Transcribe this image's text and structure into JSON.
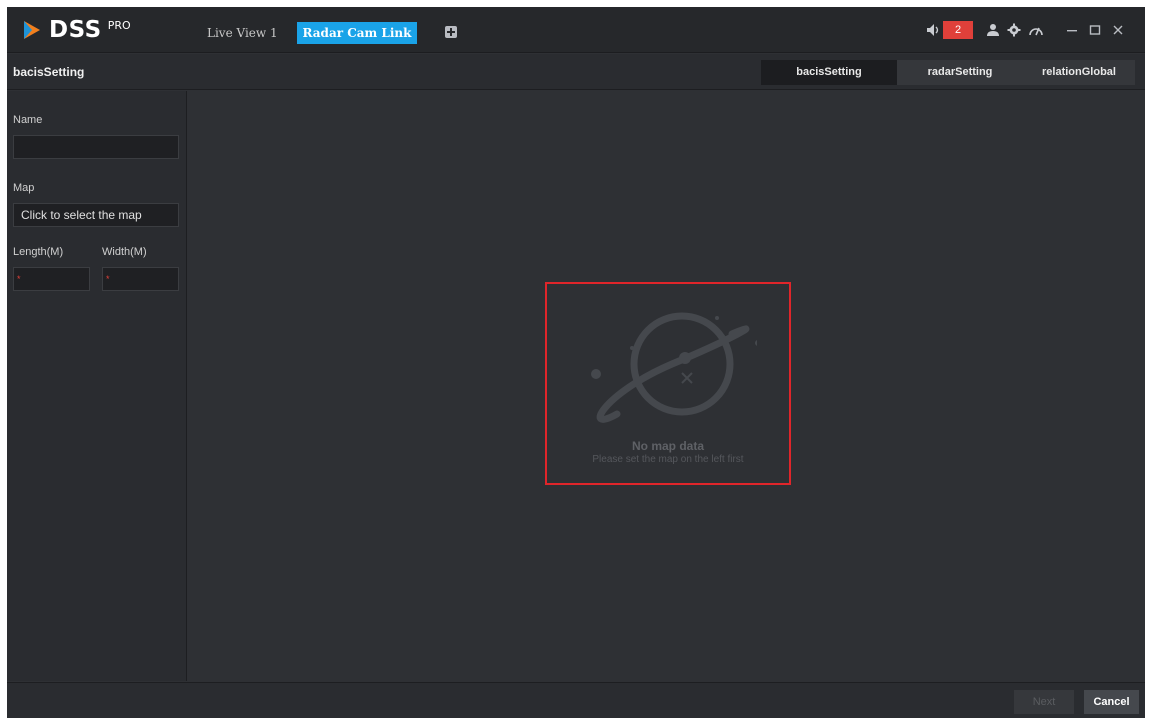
{
  "app": {
    "logo_text": "DSS",
    "logo_sup": "PRO"
  },
  "tabs": [
    {
      "label": "Live View 1"
    },
    {
      "label": "Radar Cam Link"
    }
  ],
  "tray": {
    "alarm_count": "2",
    "icons": [
      "speaker-icon",
      "user-icon",
      "gear-icon",
      "speedometer-icon",
      "minimize-icon",
      "maximize-icon",
      "close-icon"
    ]
  },
  "page": {
    "title": "bacisSetting"
  },
  "steps": [
    {
      "label": "bacisSetting"
    },
    {
      "label": "radarSetting"
    },
    {
      "label": "relationGlobal"
    }
  ],
  "form": {
    "name_label": "Name",
    "name_value": "",
    "map_label": "Map",
    "map_value": "Click to select the map",
    "length_label": "Length(M)",
    "width_label": "Width(M)",
    "required_mark": "*"
  },
  "empty_state": {
    "title": "No map data",
    "subtitle": "Please set the map on the left first"
  },
  "footer": {
    "next_label": "Next",
    "cancel_label": "Cancel"
  },
  "colors": {
    "accent": "#1aa3e8",
    "alarm": "#e0403a",
    "highlight_border": "#e0252a"
  }
}
